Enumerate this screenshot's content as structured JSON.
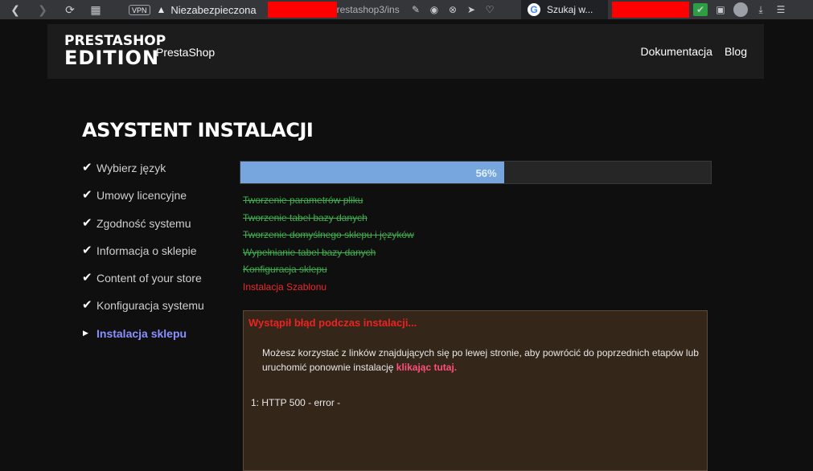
{
  "browser": {
    "vpn_label": "VPN",
    "security_text": "Niezabezpieczona",
    "url_text": "restashop3/ins",
    "search_tab_label": "Szukaj w...",
    "google_glyph": "G",
    "icons": [
      "back-icon",
      "forward-icon",
      "reload-icon",
      "tabs-icon",
      "share-icon",
      "camera-icon",
      "close-circle-icon",
      "send-icon",
      "heart-icon",
      "extension-check-icon",
      "cube-icon",
      "avatar-icon",
      "download-icon",
      "menu-icon"
    ]
  },
  "header": {
    "logo_line1": "PRESTASHOP",
    "logo_line2": "EDITION",
    "logo_subtitle": "PrestaShop",
    "nav": [
      "Dokumentacja",
      "Blog"
    ]
  },
  "page": {
    "title": "ASYSTENT INSTALACJI",
    "steps": [
      {
        "label": "Wybierz język",
        "status": "done"
      },
      {
        "label": "Umowy licencyjne",
        "status": "done"
      },
      {
        "label": "Zgodność systemu",
        "status": "done"
      },
      {
        "label": "Informacja o sklepie",
        "status": "done"
      },
      {
        "label": "Content of your store",
        "status": "done"
      },
      {
        "label": "Konfiguracja systemu",
        "status": "done"
      },
      {
        "label": "Instalacja sklepu",
        "status": "current"
      }
    ],
    "progress": {
      "percent": 56,
      "label": "56%"
    },
    "tasks": [
      {
        "label": "Tworzenie parametrów pliku",
        "status": "done"
      },
      {
        "label": "Tworzenie tabel bazy danych",
        "status": "done"
      },
      {
        "label": "Tworzenie domyślnego sklepu i języków",
        "status": "done"
      },
      {
        "label": "Wypełnianie tabel bazy danych",
        "status": "done"
      },
      {
        "label": "Konfiguracja sklepu",
        "status": "done"
      },
      {
        "label": "Instalacja Szablonu",
        "status": "error"
      }
    ],
    "error": {
      "title": "Wystąpił błąd podczas instalacji...",
      "message": "Możesz korzystać z linków znajdujących się po lewej stronie, aby powrócić do poprzednich etapów lub uruchomić ponownie instalację ",
      "link_text": "klikając tutaj.",
      "detail": "1: HTTP 500 - error -"
    },
    "colors": {
      "progress_fill": "#77a6df",
      "task_done": "#3fae4e",
      "task_error": "#ee2a2a",
      "current_step": "#8a90ff",
      "error_link": "#ff4f7b"
    }
  }
}
